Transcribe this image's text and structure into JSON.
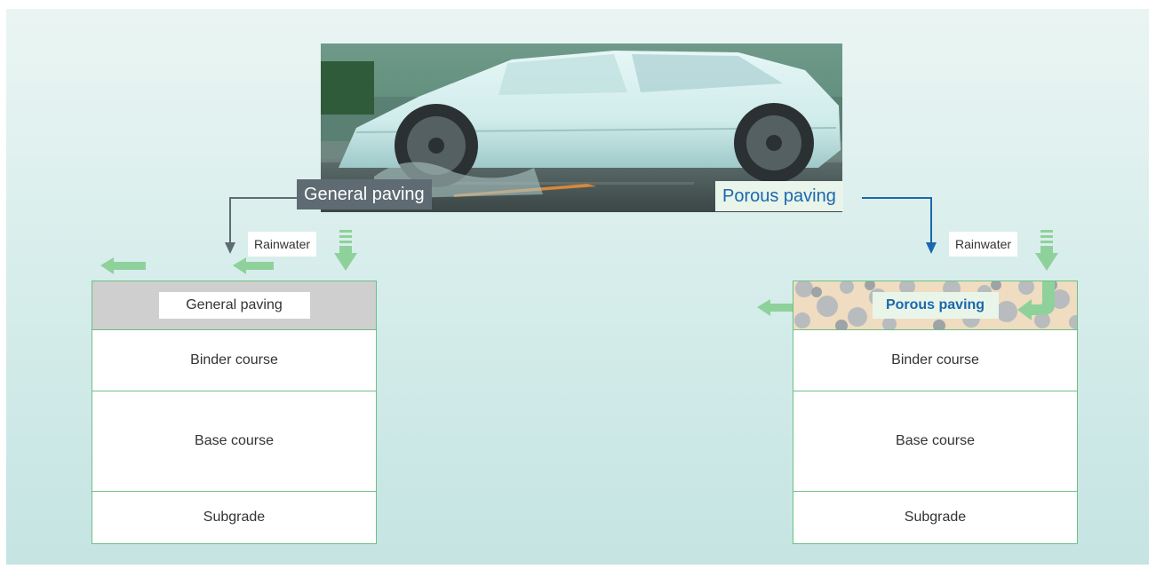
{
  "labels": {
    "general_paving_tag": "General paving",
    "porous_paving_tag": "Porous paving",
    "rainwater": "Rainwater"
  },
  "general_stack": {
    "top": "General paving",
    "binder": "Binder course",
    "base": "Base course",
    "subgrade": "Subgrade"
  },
  "porous_stack": {
    "top": "Porous paving",
    "binder": "Binder course",
    "base": "Base course",
    "subgrade": "Subgrade"
  },
  "colors": {
    "arrow_green": "#8fd19b",
    "general_gray": "#5f6b72",
    "porous_blue": "#1a68ae",
    "layer_border": "#6dc083"
  }
}
